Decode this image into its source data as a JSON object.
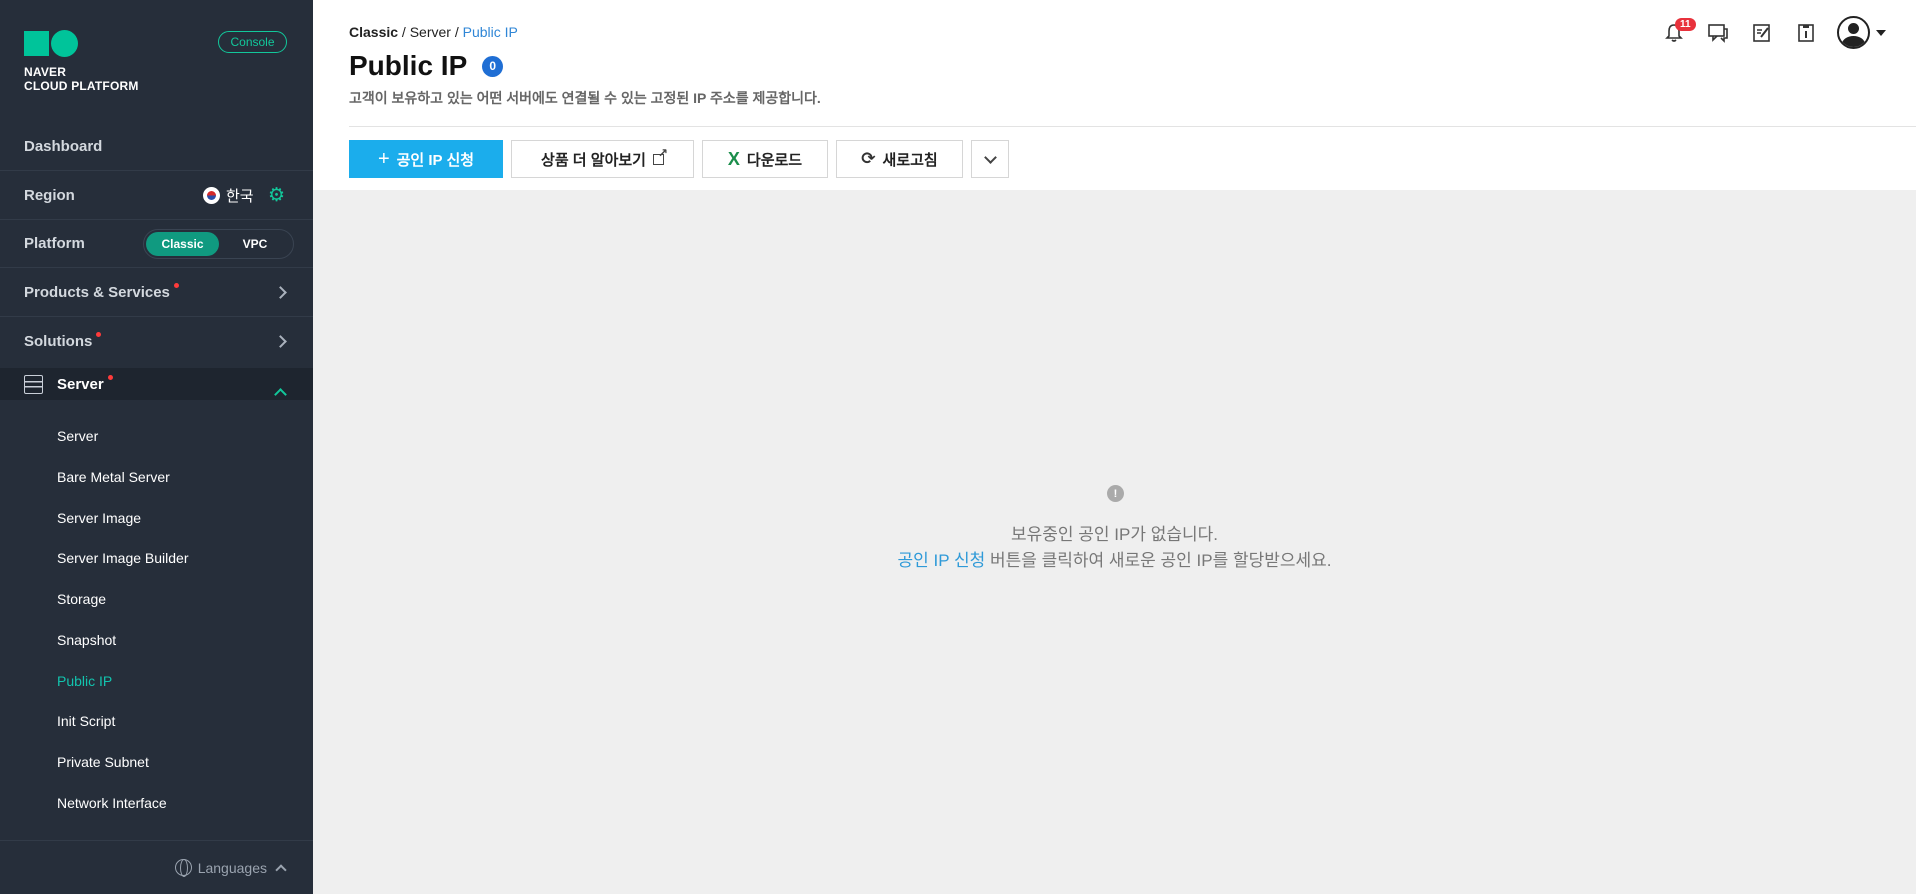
{
  "brand": {
    "line1": "NAVER",
    "line2": "CLOUD PLATFORM",
    "console_label": "Console"
  },
  "sidebar": {
    "dashboard": "Dashboard",
    "region": {
      "label": "Region",
      "value": "한국"
    },
    "platform": {
      "label": "Platform",
      "options": [
        "Classic",
        "VPC"
      ],
      "selected": "Classic"
    },
    "products": "Products & Services",
    "solutions": "Solutions",
    "section": "Server",
    "items": [
      "Server",
      "Bare Metal Server",
      "Server Image",
      "Server Image Builder",
      "Storage",
      "Snapshot",
      "Public IP",
      "Init Script",
      "Private Subnet",
      "Network Interface"
    ],
    "active_item": "Public IP",
    "languages": "Languages"
  },
  "header": {
    "breadcrumb": [
      "Classic",
      "Server",
      "Public IP"
    ],
    "title": "Public IP",
    "count": "0",
    "description": "고객이 보유하고 있는 어떤 서버에도 연결될 수 있는 고정된 IP 주소를 제공합니다.",
    "notifications": "11"
  },
  "toolbar": {
    "apply": "공인 IP 신청",
    "learn_more": "상품 더 알아보기",
    "download": "다운로드",
    "refresh": "새로고침"
  },
  "empty_state": {
    "line1": "보유중인 공인 IP가 없습니다.",
    "link": "공인 IP 신청",
    "line2_rest": " 버튼을 클릭하여 새로운 공인 IP를 할당받으세요.",
    "info_glyph": "!"
  },
  "colors": {
    "sidebar_bg": "#262e3a",
    "accent_green": "#12c89b",
    "primary_blue": "#1badec",
    "link_blue": "#2f86d6",
    "badge_red": "#e8323c"
  },
  "icons": [
    "bell-icon",
    "chat-icon",
    "memo-icon",
    "info-icon",
    "user-avatar-icon",
    "gear-icon",
    "globe-icon",
    "server-icon",
    "external-link-icon",
    "excel-icon",
    "refresh-icon",
    "chevron-down-icon"
  ]
}
